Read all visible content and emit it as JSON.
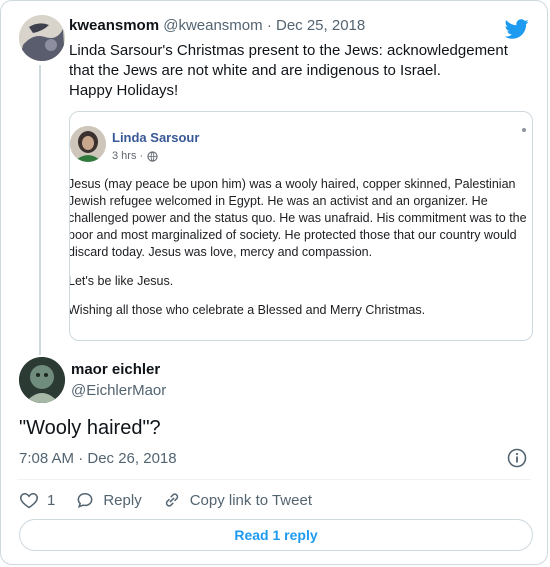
{
  "tweet": {
    "display_name": "kweansmom",
    "handle": "@kweansmom",
    "separator": " · ",
    "date": "Dec 25, 2018",
    "lines": [
      "Linda Sarsour's Christmas present to the Jews: acknowledgement",
      "that the Jews are not white and are indigenous to Israel.",
      "Happy Holidays!"
    ]
  },
  "embed": {
    "author": "Linda Sarsour",
    "meta": "3 hrs ·",
    "paragraphs": [
      "Jesus (may peace be upon him) was a wooly haired, copper skinned, Palestinian Jewish refugee welcomed in Egypt. He was an activist and an organizer. He challenged power and the status quo. He was unafraid. His commitment was to the poor and most marginalized of society. He protected those that our country would discard today. Jesus was love, mercy and compassion.",
      "Let's be like Jesus.",
      "Wishing all those who celebrate a Blessed and Merry Christmas."
    ]
  },
  "reply": {
    "display_name": "maor eichler",
    "handle": "@EichlerMaor",
    "text": "\"Wooly haired\"?",
    "timestamp": "7:08 AM · Dec 26, 2018"
  },
  "actions": {
    "like_count": "1",
    "reply_label": "Reply",
    "copy_label": "Copy link to Tweet"
  },
  "read_replies_label": "Read 1 reply",
  "colors": {
    "accent": "#1d9bf0",
    "text": "#0f1419",
    "muted": "#536471",
    "border": "#cfd9de",
    "fb_link": "#385898"
  },
  "icons": [
    "twitter-bird-icon",
    "globe-icon",
    "info-icon",
    "heart-icon",
    "reply-bubble-icon",
    "link-icon"
  ]
}
